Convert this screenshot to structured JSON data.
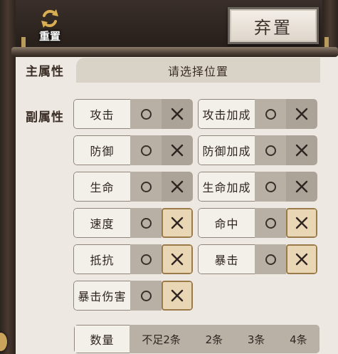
{
  "toolbar": {
    "reset_label": "重置",
    "discard_label": "弃置"
  },
  "main_attr": {
    "label": "主属性",
    "select_text": "请选择位置"
  },
  "sub_attr": {
    "label": "副属性",
    "items": [
      {
        "name": "攻击",
        "cross_selected": false
      },
      {
        "name": "攻击加成",
        "cross_selected": false
      },
      {
        "name": "防御",
        "cross_selected": false
      },
      {
        "name": "防御加成",
        "cross_selected": false
      },
      {
        "name": "生命",
        "cross_selected": false
      },
      {
        "name": "生命加成",
        "cross_selected": false
      },
      {
        "name": "速度",
        "cross_selected": true
      },
      {
        "name": "命中",
        "cross_selected": true
      },
      {
        "name": "抵抗",
        "cross_selected": true
      },
      {
        "name": "暴击",
        "cross_selected": true
      },
      {
        "name": "暴击伤害",
        "cross_selected": true
      }
    ]
  },
  "quantity": {
    "label": "数量",
    "options": [
      "不足2条",
      "2条",
      "3条",
      "4条"
    ]
  },
  "colors": {
    "panel_bg": "#ede8e2",
    "chip_option_bg": "#b8b0a5",
    "selected_bg": "#e9d6b5",
    "selected_border": "#9b7a4a",
    "reset_icon": "#d9ae52"
  },
  "icons": {
    "reset": "refresh-arrows-icon",
    "option_circle": "circle-icon",
    "option_cross": "cross-icon"
  }
}
